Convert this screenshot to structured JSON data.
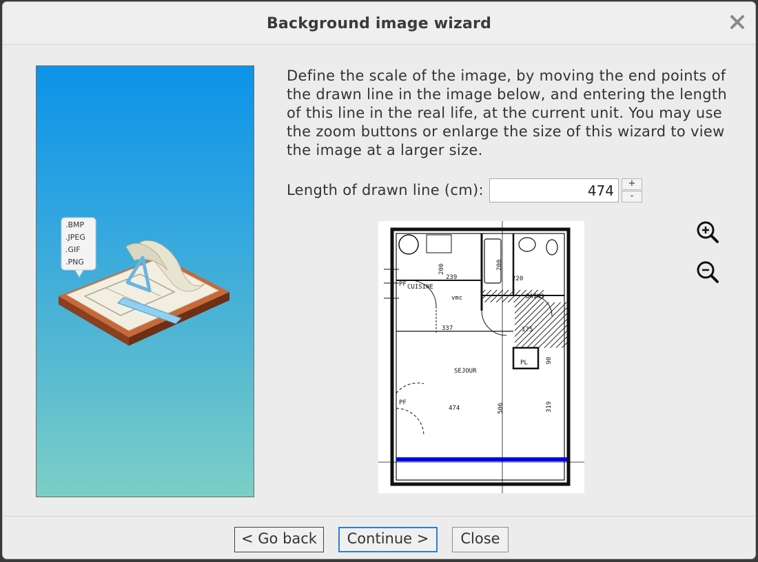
{
  "window": {
    "title": "Background image wizard",
    "close_icon": "close-icon"
  },
  "side": {
    "formats": [
      ".BMP",
      ".JPEG",
      ".GIF",
      ".PNG"
    ],
    "gradient_top": "#0c93e8",
    "gradient_bottom": "#7ccfc6"
  },
  "content": {
    "instructions": "Define the scale of the image, by moving the end points of the drawn line in the image below, and entering the length of this line in the real life, at the current unit. You may use the zoom buttons or enlarge the size of this wizard to view the image at a larger size.",
    "length_label": "Length of drawn line (cm):",
    "length_value": "474",
    "spin_up": "+",
    "spin_down": "-"
  },
  "plan": {
    "labels": {
      "cuisine": "CUISINE",
      "pf_top": "PF",
      "vmc": "vmc",
      "sejour": "SEJOUR",
      "bains": "BAINS",
      "pl": "PL",
      "pf_left": "PF",
      "d239": "239",
      "d220": "220",
      "d337": "337",
      "d175": "175",
      "d200a": "200",
      "d200b": "200",
      "d90": "90",
      "d506": "506",
      "d319": "319",
      "d474": "474"
    },
    "scale_line_color": "#0000ee"
  },
  "zoom": {
    "in_icon": "zoom-in-icon",
    "out_icon": "zoom-out-icon"
  },
  "footer": {
    "back_label": "< Go back",
    "continue_label": "Continue >",
    "close_label": "Close"
  }
}
